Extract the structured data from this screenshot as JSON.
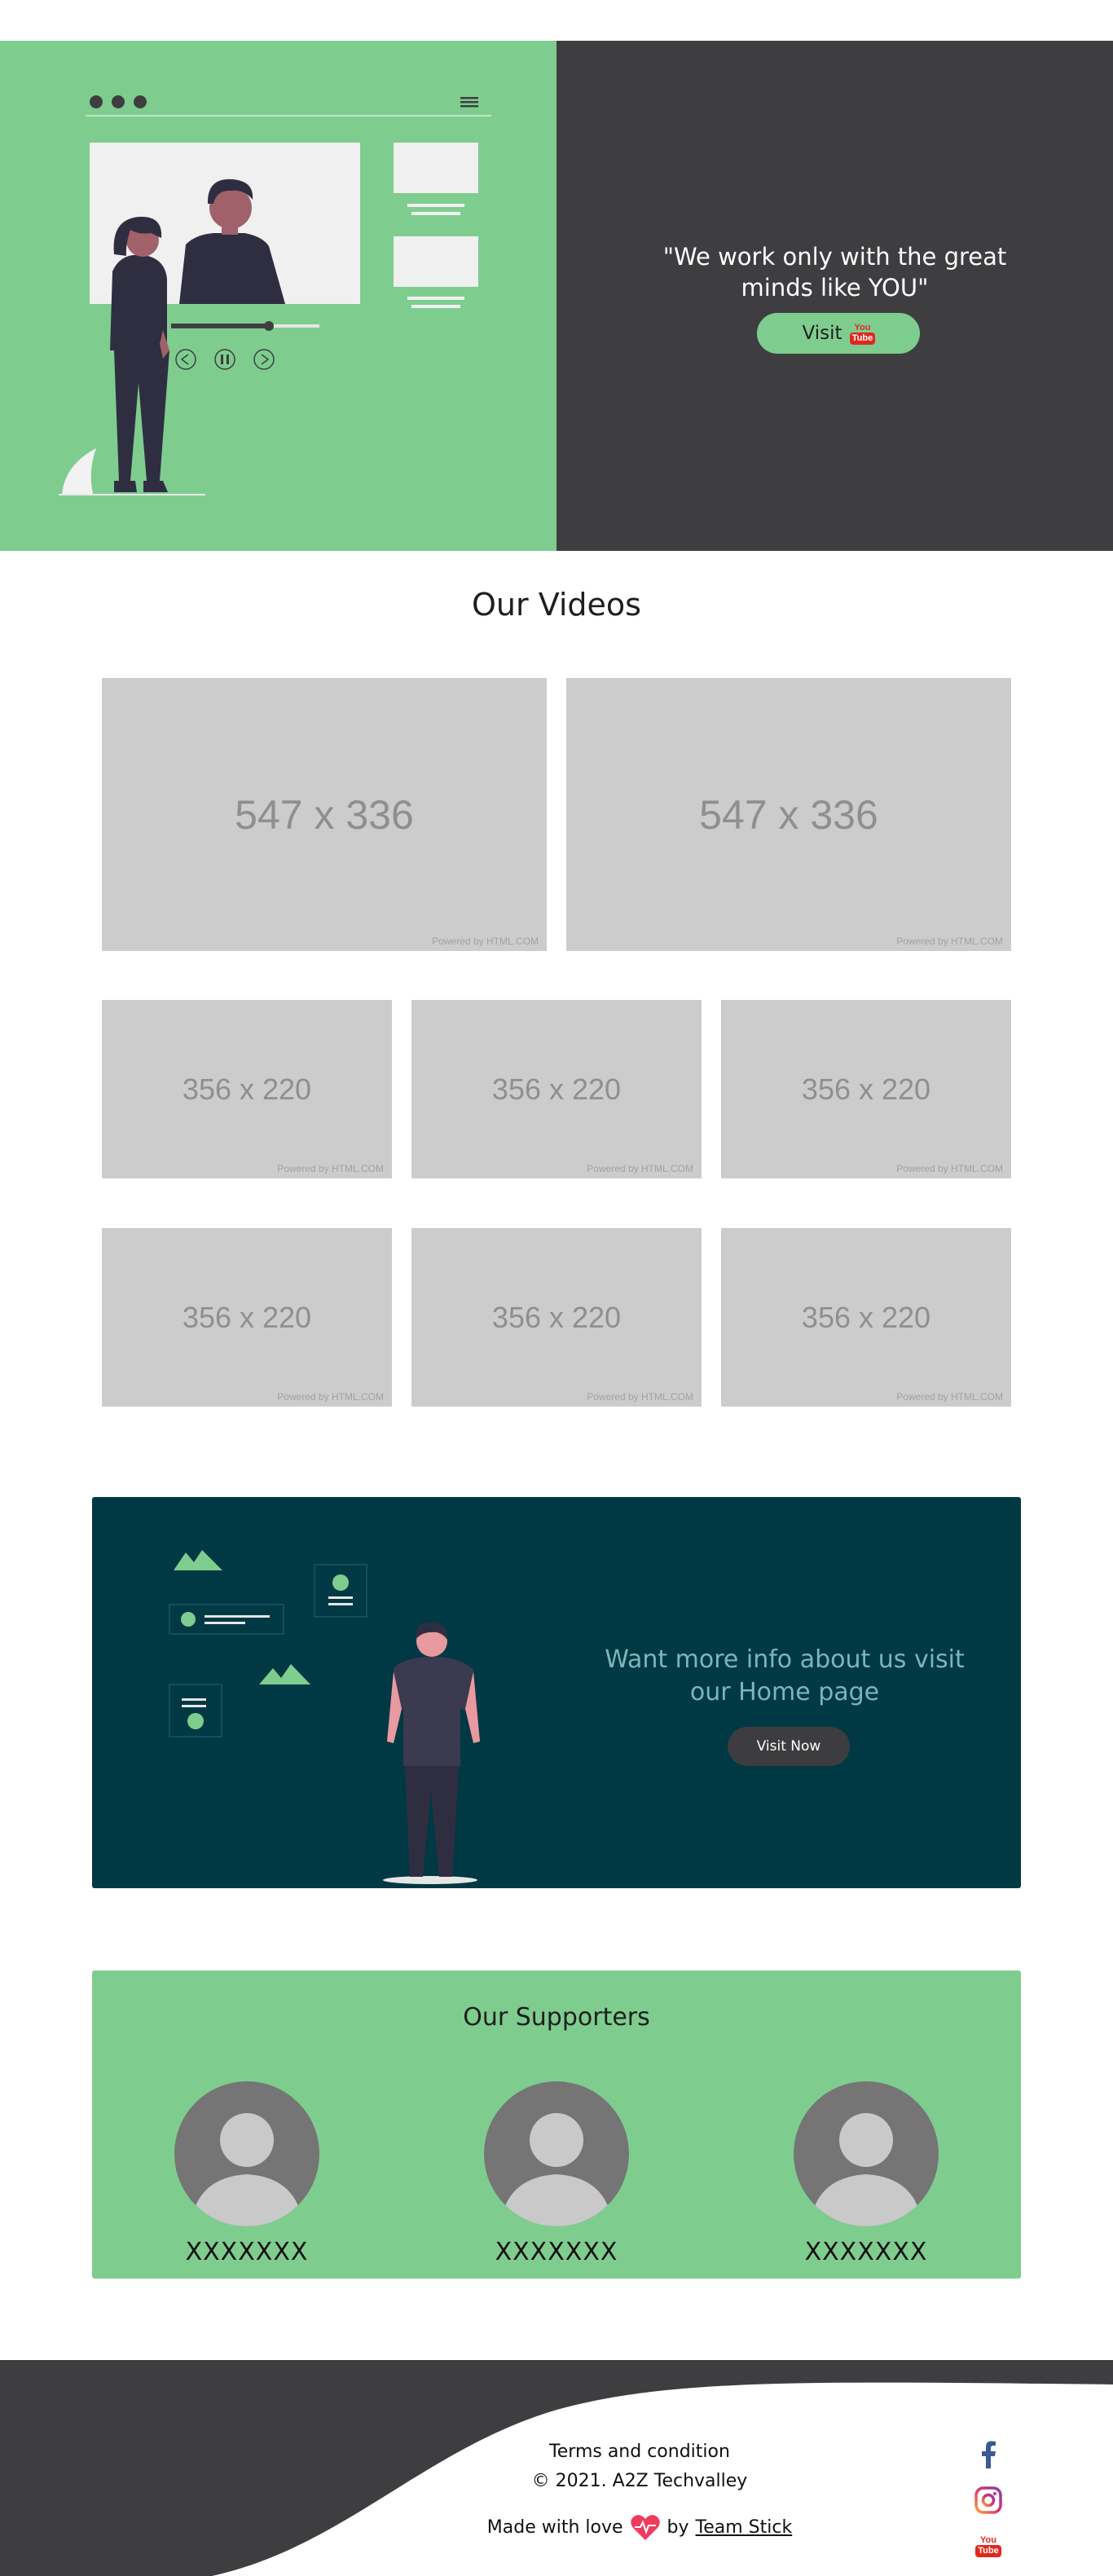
{
  "hero": {
    "quote": "\"We work only with the great minds like YOU\"",
    "visit_label": "Visit",
    "youtube_you": "You",
    "youtube_tube": "Tube"
  },
  "videos": {
    "title": "Our Videos",
    "large": [
      {
        "size": "547 x 336",
        "powered": "Powered by HTML.COM"
      },
      {
        "size": "547 x 336",
        "powered": "Powered by HTML.COM"
      }
    ],
    "small": [
      {
        "size": "356 x 220",
        "powered": "Powered by HTML.COM"
      },
      {
        "size": "356 x 220",
        "powered": "Powered by HTML.COM"
      },
      {
        "size": "356 x 220",
        "powered": "Powered by HTML.COM"
      },
      {
        "size": "356 x 220",
        "powered": "Powered by HTML.COM"
      },
      {
        "size": "356 x 220",
        "powered": "Powered by HTML.COM"
      },
      {
        "size": "356 x 220",
        "powered": "Powered by HTML.COM"
      }
    ]
  },
  "info": {
    "text": "Want more info about us visit our Home page",
    "button": "Visit Now"
  },
  "supporters": {
    "title": "Our Supporters",
    "names": [
      "XXXXXXX",
      "XXXXXXX",
      "XXXXXXX"
    ]
  },
  "footer": {
    "terms": "Terms and condition",
    "copyright": "© 2021. A2Z Techvalley",
    "made_with": "Made with love",
    "by": "by",
    "team": "Team Stick",
    "social_youtube_you": "You",
    "social_youtube_tube": "Tube"
  },
  "colors": {
    "green": "#7ecd8f",
    "dark": "#3e3e41",
    "teal": "#003844",
    "placeholder": "#cccccc"
  }
}
